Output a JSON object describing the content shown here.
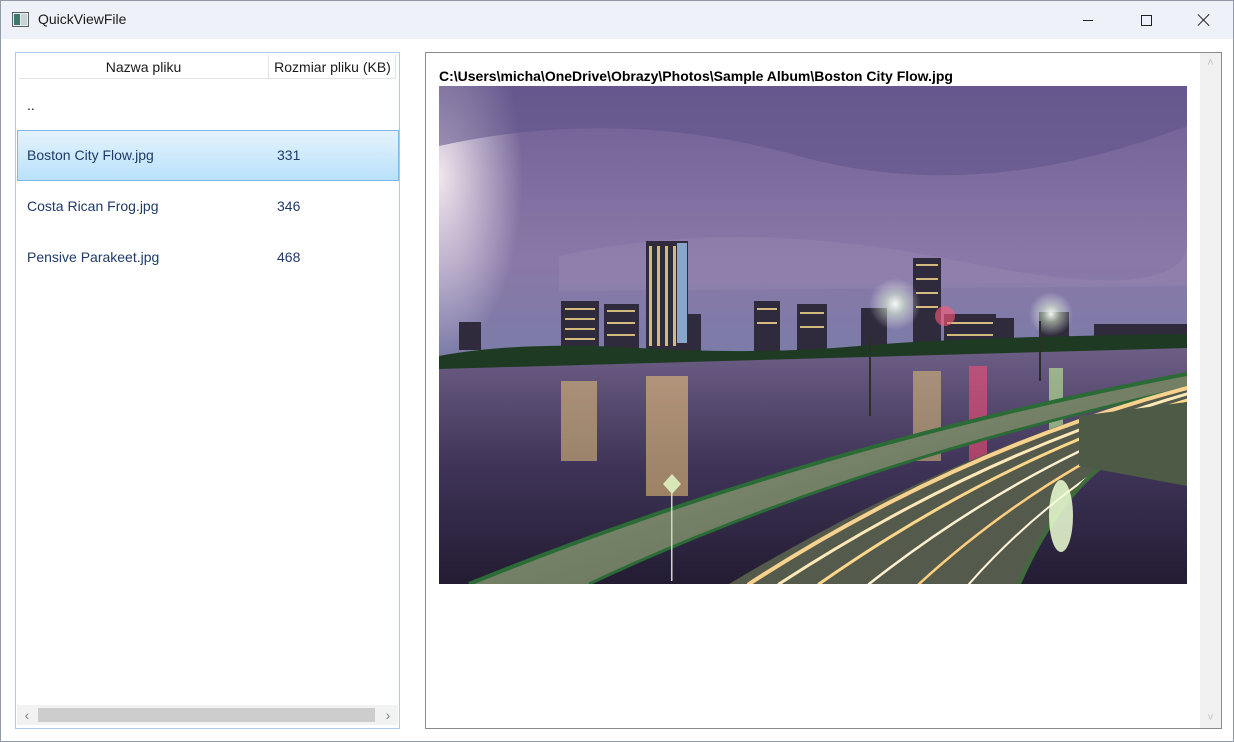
{
  "window": {
    "title": "QuickViewFile"
  },
  "list": {
    "columns": {
      "name": "Nazwa pliku",
      "size": "Rozmiar pliku (KB)"
    },
    "parent_label": "..",
    "items": [
      {
        "name": "Boston City Flow.jpg",
        "size": "331",
        "selected": true
      },
      {
        "name": "Costa Rican Frog.jpg",
        "size": "346",
        "selected": false
      },
      {
        "name": "Pensive Parakeet.jpg",
        "size": "468",
        "selected": false
      }
    ]
  },
  "preview": {
    "path": "C:\\Users\\micha\\OneDrive\\Obrazy\\Photos\\Sample Album\\Boston City Flow.jpg"
  },
  "icons": {
    "app": "app-icon",
    "minimize": "minimize-icon",
    "maximize": "maximize-icon",
    "close": "close-icon",
    "scroll_left": "chevron-left-icon",
    "scroll_right": "chevron-right-icon",
    "scroll_up": "chevron-up-icon",
    "scroll_down": "chevron-down-icon"
  },
  "colors": {
    "selection_top": "#e4f3fd",
    "selection_bottom": "#b9e1fa",
    "list_text": "#1f3a68",
    "titlebar_bg": "#eef1f8"
  }
}
